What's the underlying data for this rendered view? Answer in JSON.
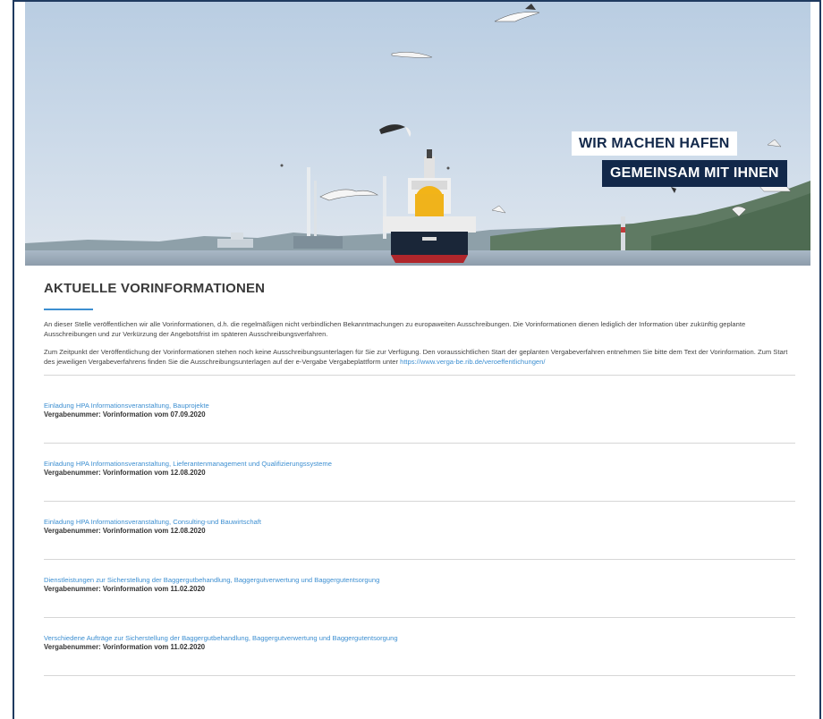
{
  "hero": {
    "slogan_line1": "WIR MACHEN HAFEN",
    "slogan_line2": "GEMEINSAM MIT IHNEN"
  },
  "section": {
    "title": "AKTUELLE VORINFORMATIONEN",
    "intro_1": "An dieser Stelle veröffentlichen wir alle Vorinformationen, d.h. die regelmäßigen nicht verbindlichen Bekanntmachungen zu europaweiten Ausschreibungen. Die Vorinformationen dienen lediglich der Information über zukünftig geplante Ausschreibungen und zur Verkürzung der Angebotsfrist im späteren Ausschreibungsverfahren.",
    "intro_2": "Zum Zeitpunkt der Veröffentlichung der Vorinformationen stehen noch keine Ausschreibungsunterlagen für Sie zur Verfügung. Den voraussichtlichen Start der geplanten Vergabeverfahren entnehmen Sie bitte dem Text der Vorinformation. Zum Start des jeweiligen Vergabeverfahrens finden Sie die Ausschreibungsunterlagen auf der e-Vergabe Vergabeplattform unter ",
    "intro_link": "https://www.verga-be.rib.de/veroeffentlichungen/"
  },
  "items": [
    {
      "title": "Einladung HPA Informationsveranstaltung, Bauprojekte",
      "meta": "Vergabenummer: Vorinformation vom 07.09.2020"
    },
    {
      "title": "Einladung HPA Informationsveranstaltung, Lieferantenmanagement und Qualifizierungssysteme",
      "meta": "Vergabenummer: Vorinformation vom 12.08.2020"
    },
    {
      "title": "Einladung HPA Informationsveranstaltung, Consulting-und Bauwirtschaft",
      "meta": "Vergabenummer: Vorinformation vom 12.08.2020"
    },
    {
      "title": "Dienstleistungen zur Sicherstellung der Baggergutbehandlung, Baggergutverwertung und Baggergutentsorgung",
      "meta": "Vergabenummer: Vorinformation vom 11.02.2020"
    },
    {
      "title": "Verschiedene Aufträge zur Sicherstellung der Baggergutbehandlung, Baggergutverwertung und Baggergutentsorgung",
      "meta": "Vergabenummer: Vorinformation vom 11.02.2020"
    }
  ]
}
